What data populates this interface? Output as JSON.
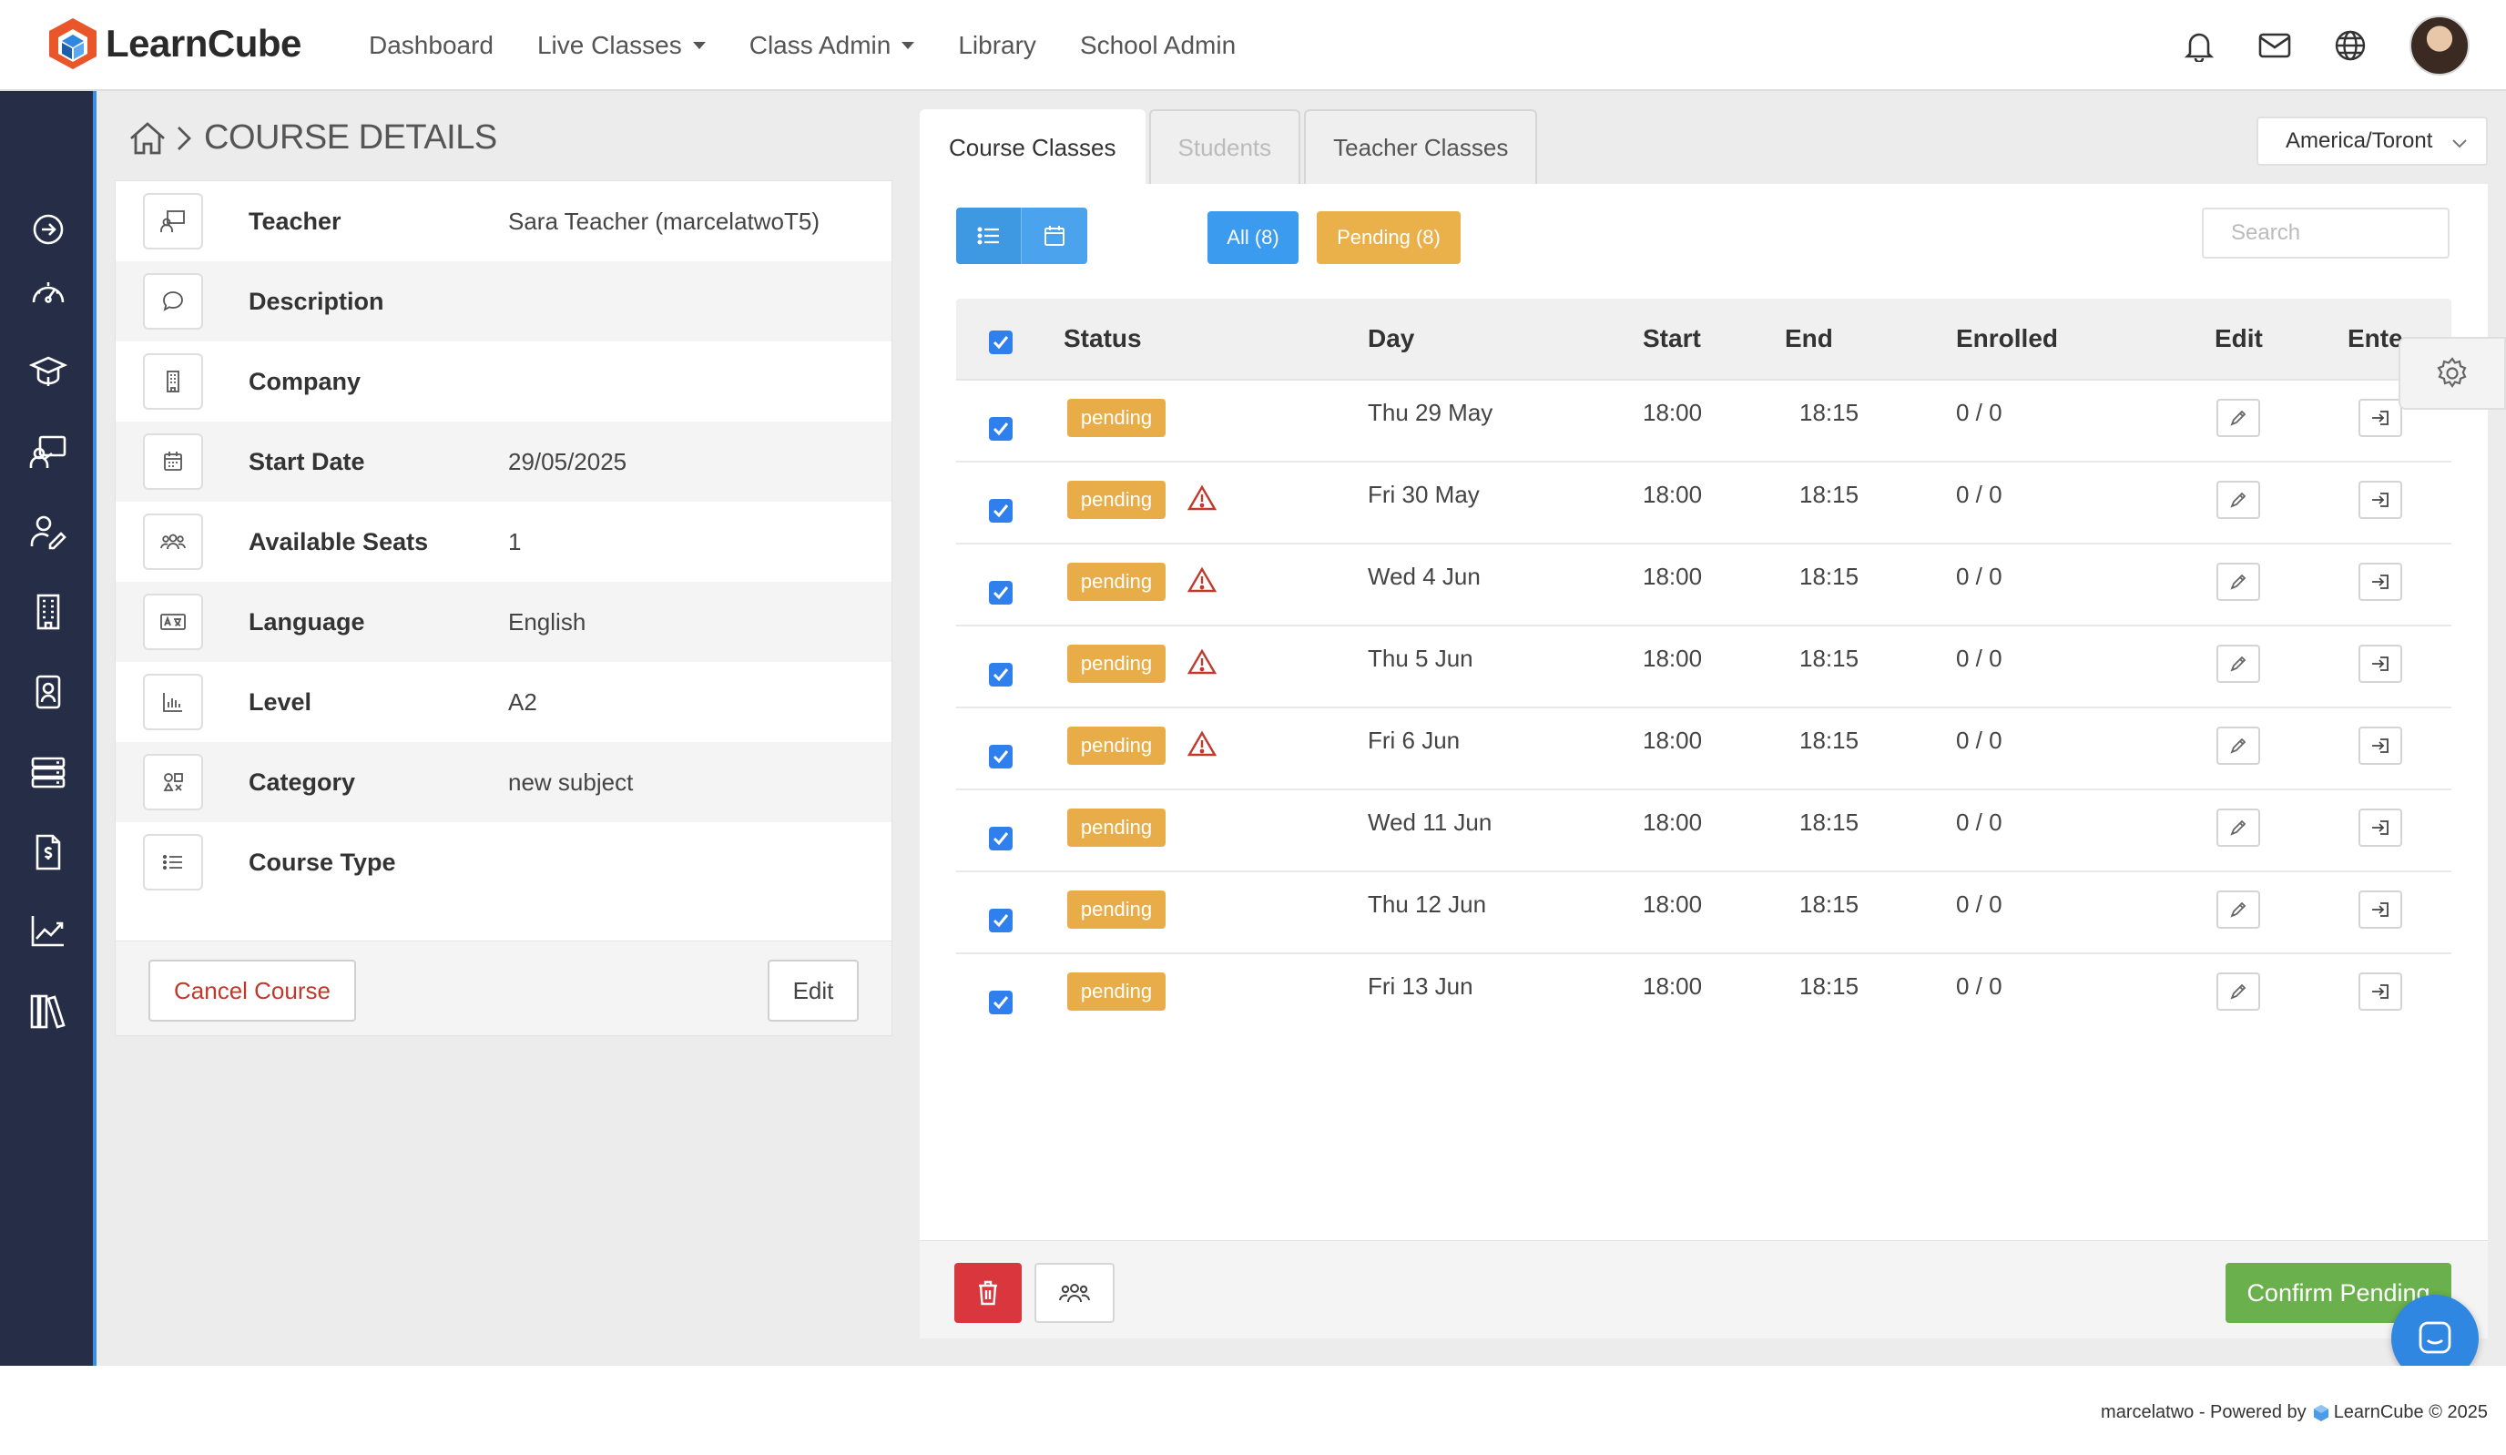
{
  "app": {
    "name": "LearnCube"
  },
  "nav": {
    "items": [
      {
        "label": "Dashboard",
        "dropdown": false
      },
      {
        "label": "Live Classes",
        "dropdown": true
      },
      {
        "label": "Class Admin",
        "dropdown": true
      },
      {
        "label": "Library",
        "dropdown": false
      },
      {
        "label": "School Admin",
        "dropdown": false
      }
    ]
  },
  "topbar": {
    "icons": [
      "bell-icon",
      "mail-icon",
      "globe-icon"
    ],
    "avatar": "user-avatar"
  },
  "sidebar": {
    "icons": [
      "arrow-right-circle-icon",
      "dashboard-gauge-icon",
      "graduation-cap-icon",
      "teacher-board-icon",
      "user-edit-icon",
      "building-icon",
      "id-badge-icon",
      "server-icon",
      "billing-document-icon",
      "chart-line-icon",
      "library-books-icon"
    ]
  },
  "page": {
    "title": "COURSE DETAILS"
  },
  "details": {
    "rows": [
      {
        "icon": "teacher-icon",
        "label": "Teacher",
        "value": "Sara Teacher (marcelatwoT5)"
      },
      {
        "icon": "speech-bubble-icon",
        "label": "Description",
        "value": ""
      },
      {
        "icon": "building-icon",
        "label": "Company",
        "value": ""
      },
      {
        "icon": "calendar-icon",
        "label": "Start Date",
        "value": "29/05/2025"
      },
      {
        "icon": "users-icon",
        "label": "Available Seats",
        "value": "1"
      },
      {
        "icon": "language-icon",
        "label": "Language",
        "value": "English"
      },
      {
        "icon": "bar-chart-icon",
        "label": "Level",
        "value": "A2"
      },
      {
        "icon": "category-icon",
        "label": "Category",
        "value": "new subject"
      },
      {
        "icon": "list-icon",
        "label": "Course Type",
        "value": ""
      }
    ],
    "cancel_label": "Cancel Course",
    "edit_label": "Edit"
  },
  "tabs": [
    {
      "label": "Course Classes",
      "state": "active"
    },
    {
      "label": "Students",
      "state": "disabled"
    },
    {
      "label": "Teacher Classes",
      "state": "normal"
    }
  ],
  "timezone": {
    "value": "America/Toront"
  },
  "filters": {
    "all": "All (8)",
    "pending": "Pending (8)"
  },
  "search": {
    "placeholder": "Search"
  },
  "table": {
    "columns": [
      "Status",
      "Day",
      "Start",
      "End",
      "Enrolled",
      "Edit",
      "Ente"
    ],
    "rows": [
      {
        "checked": true,
        "status": "pending",
        "warning": false,
        "day": "Thu 29 May",
        "start": "18:00",
        "end": "18:15",
        "enrolled": "0 / 0"
      },
      {
        "checked": true,
        "status": "pending",
        "warning": true,
        "day": "Fri 30 May",
        "start": "18:00",
        "end": "18:15",
        "enrolled": "0 / 0"
      },
      {
        "checked": true,
        "status": "pending",
        "warning": true,
        "day": "Wed 4 Jun",
        "start": "18:00",
        "end": "18:15",
        "enrolled": "0 / 0"
      },
      {
        "checked": true,
        "status": "pending",
        "warning": true,
        "day": "Thu 5 Jun",
        "start": "18:00",
        "end": "18:15",
        "enrolled": "0 / 0"
      },
      {
        "checked": true,
        "status": "pending",
        "warning": true,
        "day": "Fri 6 Jun",
        "start": "18:00",
        "end": "18:15",
        "enrolled": "0 / 0"
      },
      {
        "checked": true,
        "status": "pending",
        "warning": false,
        "day": "Wed 11 Jun",
        "start": "18:00",
        "end": "18:15",
        "enrolled": "0 / 0"
      },
      {
        "checked": true,
        "status": "pending",
        "warning": false,
        "day": "Thu 12 Jun",
        "start": "18:00",
        "end": "18:15",
        "enrolled": "0 / 0"
      },
      {
        "checked": true,
        "status": "pending",
        "warning": false,
        "day": "Fri 13 Jun",
        "start": "18:00",
        "end": "18:15",
        "enrolled": "0 / 0"
      }
    ]
  },
  "actions": {
    "confirm_label": "Confirm Pending"
  },
  "footer": {
    "text": "marcelatwo - Powered by",
    "brand": "LearnCube © 2025"
  },
  "colors": {
    "sidebar": "#262d46",
    "accent": "#3a9bef",
    "pending": "#eab04a",
    "danger": "#d9363e",
    "confirm": "#6ab04c"
  }
}
